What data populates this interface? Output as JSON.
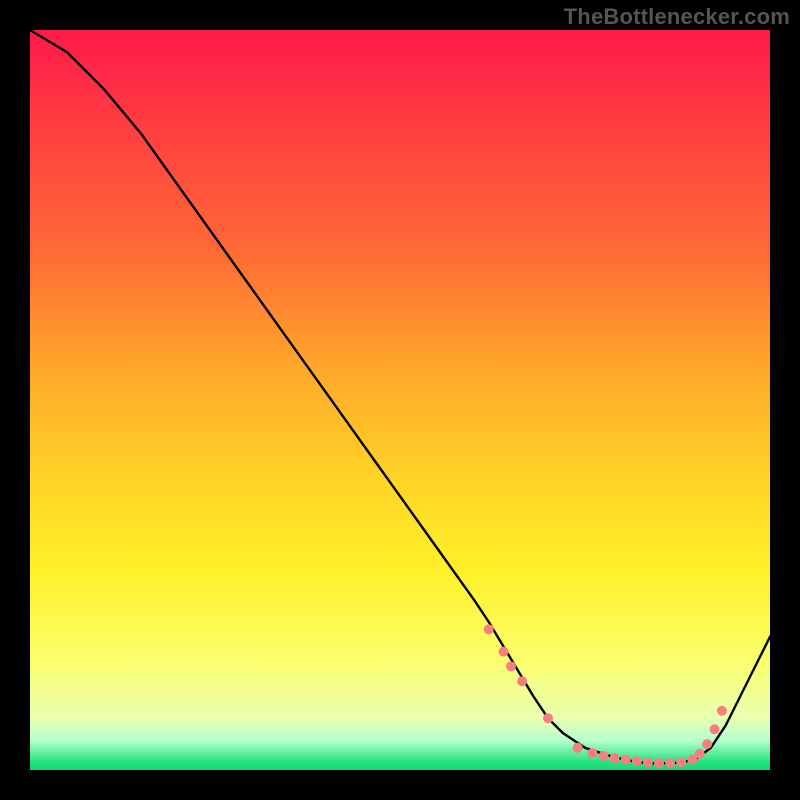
{
  "attribution": "TheBottlenecker.com",
  "chart_data": {
    "type": "line",
    "title": "",
    "xlabel": "",
    "ylabel": "",
    "xlim": [
      0,
      100
    ],
    "ylim": [
      0,
      100
    ],
    "series": [
      {
        "name": "bottleneck-curve",
        "x": [
          0,
          5,
          10,
          15,
          20,
          25,
          30,
          35,
          40,
          45,
          50,
          55,
          60,
          62,
          65,
          68,
          70,
          72,
          75,
          78,
          80,
          82,
          84,
          86,
          88,
          90,
          92,
          94,
          96,
          98,
          100
        ],
        "y": [
          100,
          97,
          92,
          86,
          79,
          72,
          65,
          58,
          51,
          44,
          37,
          30,
          23,
          20,
          15,
          10,
          7,
          5,
          3,
          2,
          1.5,
          1.1,
          0.9,
          0.9,
          1.0,
          1.5,
          3,
          6,
          10,
          14,
          18
        ]
      }
    ],
    "highlight_points": {
      "name": "marked-points",
      "x": [
        62,
        64,
        65,
        66.5,
        70,
        74,
        76,
        77.5,
        79,
        80.5,
        82,
        83.5,
        85,
        86.5,
        88,
        89.5,
        90.5,
        91.5,
        92.5,
        93.5
      ],
      "y": [
        19,
        16,
        14,
        12,
        7,
        3,
        2.3,
        1.9,
        1.6,
        1.4,
        1.2,
        1.05,
        0.95,
        0.95,
        1.05,
        1.4,
        2.2,
        3.5,
        5.5,
        8
      ]
    }
  }
}
